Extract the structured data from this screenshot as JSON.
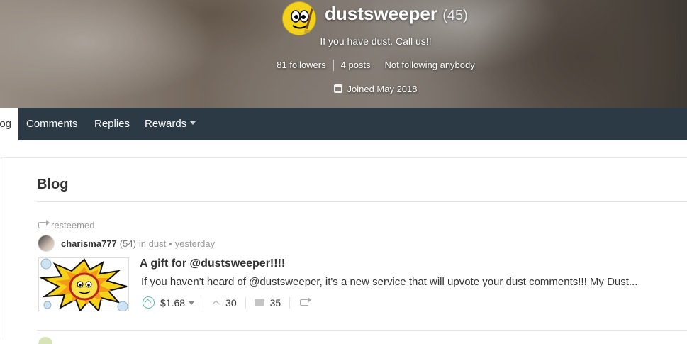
{
  "profile": {
    "username": "dustsweeper",
    "reputation": "(45)",
    "about": "If you have dust. Call us!!",
    "followers": "81 followers",
    "posts": "4 posts",
    "following": "Not following anybody",
    "joined": "Joined May 2018"
  },
  "nav": {
    "tabs": [
      {
        "label": "og"
      },
      {
        "label": "Comments"
      },
      {
        "label": "Replies"
      },
      {
        "label": "Rewards"
      }
    ]
  },
  "main": {
    "title": "Blog",
    "posts": [
      {
        "resteemed_label": "resteemed",
        "author": "charisma777",
        "author_rep": "(54)",
        "community": "in dust",
        "separator": "•",
        "time": "yesterday",
        "title": "A gift for @dustsweeper!!!!",
        "body": "If you haven't heard of @dustsweeper, it's a new service that will upvote your dust comments!!! My Dust...",
        "payout": "$1.68",
        "votes": "30",
        "comments": "35"
      }
    ]
  },
  "colors": {
    "nav_bg": "#2c3a46",
    "upvote": "#5bc0a3",
    "text": "#333333",
    "muted": "#999999"
  },
  "icons": [
    "calendar-icon",
    "resteem-icon",
    "upvote-icon",
    "votes-icon",
    "comments-icon",
    "caret-down-icon"
  ]
}
